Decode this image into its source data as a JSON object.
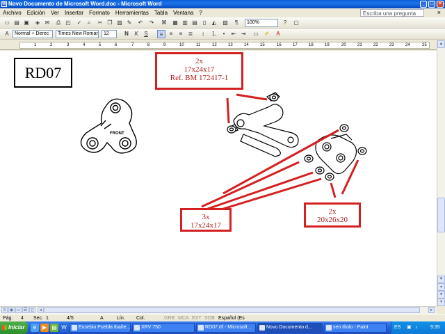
{
  "window": {
    "title": "Novo Documento de Microsoft Word.doc - Microsoft Word",
    "controls": [
      "_",
      "□",
      "×"
    ]
  },
  "menubar": {
    "items": [
      "Archivo",
      "Edición",
      "Ver",
      "Insertar",
      "Formato",
      "Herramientas",
      "Tabla",
      "Ventana",
      "?"
    ],
    "ask_placeholder": "Escriba una pregunta",
    "close": "×"
  },
  "toolbar1": {
    "zoom": "100%"
  },
  "toolbar2": {
    "style": "Normal + Derec",
    "font": "Times New Roman",
    "size": "12"
  },
  "ruler": {
    "labels": [
      "1",
      "2",
      "3",
      "4",
      "5",
      "6",
      "7",
      "8",
      "9",
      "10",
      "11",
      "12",
      "13",
      "14",
      "15",
      "16",
      "17",
      "18",
      "19",
      "20",
      "21",
      "22",
      "23",
      "24",
      "25"
    ]
  },
  "document": {
    "code_box": "RD07",
    "callout_top": [
      "2x",
      "17x24x17",
      "Ref. BM 172417-1"
    ],
    "callout_left": [
      "3x",
      "17x24x17"
    ],
    "callout_right": [
      "2x",
      "20x26x20"
    ],
    "part_label": "FRONT",
    "colors": {
      "callout": "#d42020",
      "callout_text": "#b22020"
    }
  },
  "statusbar": {
    "page": "Pág.",
    "page_num": "4",
    "sec": "Sec.",
    "sec_num": "1",
    "pages": "4/5",
    "at": "A",
    "ln": "Lín.",
    "col": "Col.",
    "grb": "GRB",
    "mca": "MCA",
    "ext": "EXT",
    "sob": "SOB",
    "lang": "Español (Es"
  },
  "taskbar": {
    "start": "Iniciar",
    "tasks": [
      "Eusebio Puebla Ibañe...",
      "XRV 750",
      "RD07.rtf - Microsoft ...",
      "Novo Documento d...",
      "sen título - Paint"
    ],
    "tray_lang": "ES",
    "clock": "9:35"
  }
}
